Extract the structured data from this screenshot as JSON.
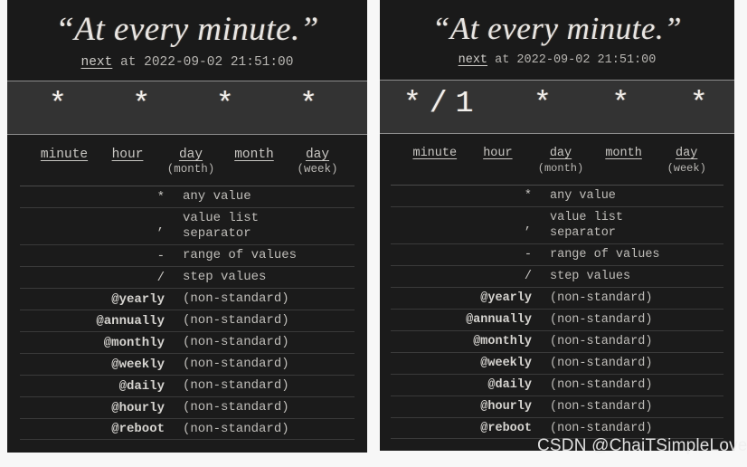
{
  "panels": [
    {
      "id": "left",
      "title": "“At every minute.”",
      "next_prefix": "next",
      "next_text": " at 2022-09-02 21:51:00",
      "expression": "*  *  *  *  *",
      "fields": [
        {
          "name": "minute",
          "sub": ""
        },
        {
          "name": "hour",
          "sub": ""
        },
        {
          "name": "day",
          "sub": "(month)"
        },
        {
          "name": "month",
          "sub": ""
        },
        {
          "name": "day",
          "sub": "(week)"
        }
      ],
      "legend": [
        {
          "symbol": "*",
          "desc": "any value",
          "bold": false
        },
        {
          "symbol": ",",
          "desc": "value list\nseparator",
          "bold": false
        },
        {
          "symbol": "-",
          "desc": "range of values",
          "bold": false
        },
        {
          "symbol": "/",
          "desc": "step values",
          "bold": false
        },
        {
          "symbol": "@yearly",
          "desc": "(non-standard)",
          "bold": true
        },
        {
          "symbol": "@annually",
          "desc": "(non-standard)",
          "bold": true
        },
        {
          "symbol": "@monthly",
          "desc": "(non-standard)",
          "bold": true
        },
        {
          "symbol": "@weekly",
          "desc": "(non-standard)",
          "bold": true
        },
        {
          "symbol": "@daily",
          "desc": "(non-standard)",
          "bold": true
        },
        {
          "symbol": "@hourly",
          "desc": "(non-standard)",
          "bold": true
        },
        {
          "symbol": "@reboot",
          "desc": "(non-standard)",
          "bold": true
        }
      ]
    },
    {
      "id": "right",
      "title": "“At every minute.”",
      "next_prefix": "next",
      "next_text": " at 2022-09-02 21:51:00",
      "expression": "*/1  *  *  *  *",
      "fields": [
        {
          "name": "minute",
          "sub": ""
        },
        {
          "name": "hour",
          "sub": ""
        },
        {
          "name": "day",
          "sub": "(month)"
        },
        {
          "name": "month",
          "sub": ""
        },
        {
          "name": "day",
          "sub": "(week)"
        }
      ],
      "legend": [
        {
          "symbol": "*",
          "desc": "any value",
          "bold": false
        },
        {
          "symbol": ",",
          "desc": "value list\nseparator",
          "bold": false
        },
        {
          "symbol": "-",
          "desc": "range of values",
          "bold": false
        },
        {
          "symbol": "/",
          "desc": "step values",
          "bold": false
        },
        {
          "symbol": "@yearly",
          "desc": "(non-standard)",
          "bold": true
        },
        {
          "symbol": "@annually",
          "desc": "(non-standard)",
          "bold": true
        },
        {
          "symbol": "@monthly",
          "desc": "(non-standard)",
          "bold": true
        },
        {
          "symbol": "@weekly",
          "desc": "(non-standard)",
          "bold": true
        },
        {
          "symbol": "@daily",
          "desc": "(non-standard)",
          "bold": true
        },
        {
          "symbol": "@hourly",
          "desc": "(non-standard)",
          "bold": true
        },
        {
          "symbol": "@reboot",
          "desc": "(non-standard)",
          "bold": true
        }
      ]
    }
  ],
  "watermark": "CSDN @ChaiTSimpleLove",
  "colors": {
    "page_background": "#f7f7f7",
    "panel_background": "#1b1b1b",
    "header_background": "#1a1a1a",
    "expression_background": "#333333",
    "text_primary": "#e8e6e3",
    "text_secondary": "#c0beba",
    "divider": "#3a3a3a"
  }
}
